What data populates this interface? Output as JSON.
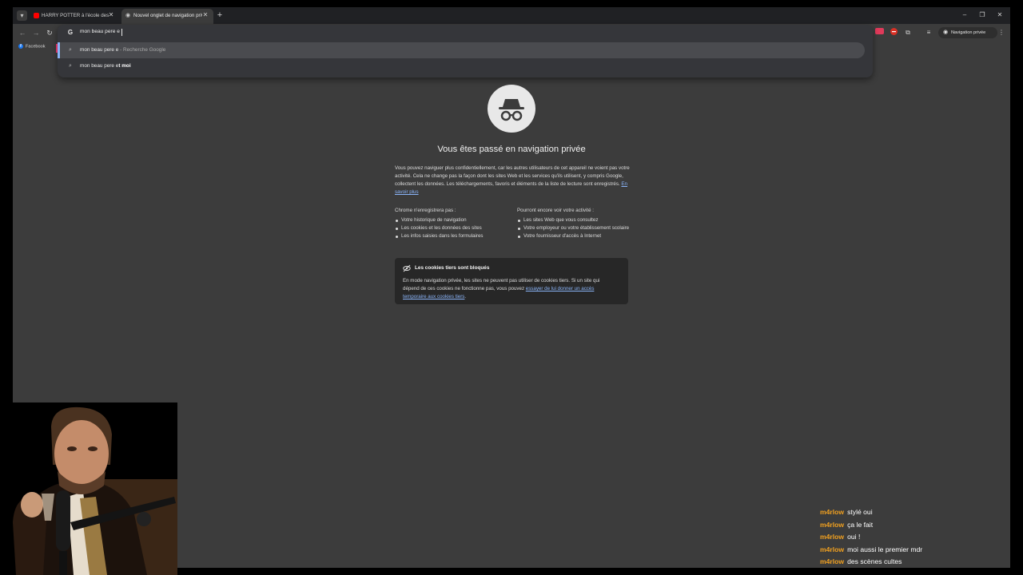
{
  "tabs": [
    {
      "title": "HARRY POTTER à l'école des sorciers",
      "favicon": "youtube-icon",
      "active": false
    },
    {
      "title": "Nouvel onglet de navigation privée",
      "favicon": "incognito-icon",
      "active": true
    }
  ],
  "omnibox": {
    "query": "mon beau pere e",
    "suggestions": [
      {
        "main": "mon beau pere e",
        "suffix": " - Recherche Google"
      },
      {
        "prefix": "mon beau pere e",
        "completion": "t moi"
      }
    ]
  },
  "toolbar": {
    "incognito_label": "Navigation privée"
  },
  "bookmarks": [
    {
      "label": "Facebook"
    }
  ],
  "ntp": {
    "title": "Vous êtes passé en navigation privée",
    "description": "Vous pouvez naviguer plus confidentiellement, car les autres utilisateurs de cet appareil ne voient pas votre activité. Cela ne change pas la façon dont les sites Web et les services qu'ils utilisent, y compris Google, collectent les données. Les téléchargements, favoris et éléments de la liste de lecture sont enregistrés.",
    "learn_more": "En savoir plus",
    "left_heading": "Chrome n'enregistrera pas :",
    "left_items": [
      "Votre historique de navigation",
      "Les cookies et les données des sites",
      "Les infos saisies dans les formulaires"
    ],
    "right_heading": "Pourront encore voir votre activité :",
    "right_items": [
      "Les sites Web que vous consultez",
      "Votre employeur ou votre établissement scolaire",
      "Votre fournisseur d'accès à Internet"
    ],
    "cookie_title": "Les cookies tiers sont bloqués",
    "cookie_body": "En mode navigation privée, les sites ne peuvent pas utiliser de cookies tiers. Si un site qui dépend de ces cookies ne fonctionne pas, vous pouvez ",
    "cookie_link": "essayer de lui donner un accès temporaire aux cookies tiers",
    "cookie_end": "."
  },
  "chat": [
    {
      "user": "m4rlow",
      "message": "stylé oui"
    },
    {
      "user": "m4rlow",
      "message": "ça le fait"
    },
    {
      "user": "m4rlow",
      "message": "oui !"
    },
    {
      "user": "m4rlow",
      "message": "moi aussi le premier mdr"
    },
    {
      "user": "m4rlow",
      "message": "des scènes cultes"
    }
  ],
  "colors": {
    "tab_strip": "#202124",
    "toolbar": "#3c3c3c",
    "omnibox": "#35363a",
    "link": "#8ab4f8",
    "chat_user": "#f0a020"
  }
}
